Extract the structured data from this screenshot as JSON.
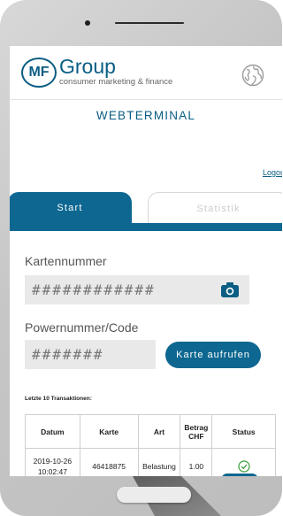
{
  "header": {
    "logo_initials": "MF",
    "logo_name": "Group",
    "logo_tagline": "consumer marketing & finance",
    "page_title": "WEBTERMINAL",
    "logout_label": "Logou"
  },
  "tabs": [
    {
      "label": "Start",
      "active": true
    },
    {
      "label": "Statistik",
      "active": false
    }
  ],
  "form": {
    "card_label": "Kartennummer",
    "card_placeholder": "############",
    "code_label": "Powernummer/Code",
    "code_placeholder": "#######",
    "submit_label": "Karte aufrufen"
  },
  "transactions": {
    "title": "Letzte 10 Transaktionen:",
    "headers": [
      "Datum",
      "Karte",
      "Art",
      "Betrag CHF",
      "Status"
    ],
    "rows": [
      {
        "date": "2019-10-26",
        "time": "10:02:47",
        "card": "46418875",
        "type": "Belastung",
        "amount": "1.00",
        "status": "ok"
      }
    ]
  },
  "colors": {
    "brand": "#0b5d83",
    "accent": "#0d6791",
    "status_ok": "#3a9a3a"
  },
  "icons": [
    "globe-icon",
    "camera-icon",
    "check-circle-icon"
  ]
}
